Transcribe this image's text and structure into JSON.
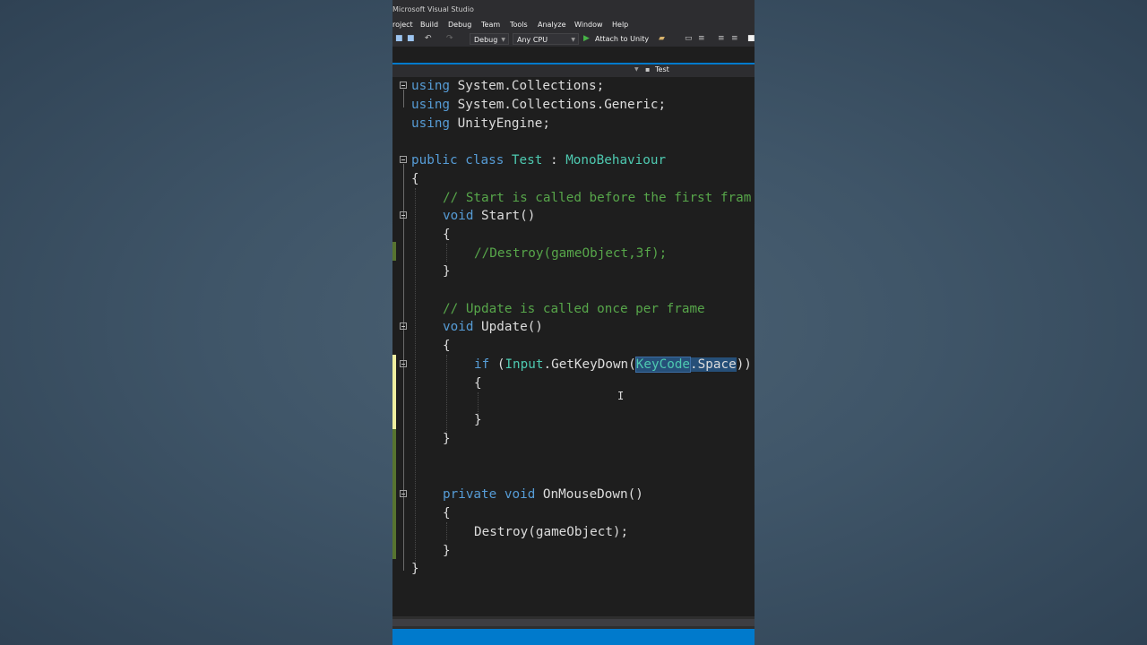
{
  "window": {
    "title": "Microsoft Visual Studio"
  },
  "menu": [
    "roject",
    "Build",
    "Debug",
    "Team",
    "Tools",
    "Analyze",
    "Window",
    "Help"
  ],
  "toolbar": {
    "config": "Debug",
    "platform": "Any CPU",
    "attach_label": "Attach to Unity",
    "icons": [
      "save-icon",
      "save-all-icon",
      "undo-icon",
      "redo-icon",
      "play-icon",
      "folder-icon",
      "bookmark-icon",
      "format-icon",
      "comment-icon"
    ]
  },
  "navbar": {
    "member": "Test"
  },
  "editor": {
    "colors": {
      "keyword": "#569cd6",
      "type": "#4ec9b0",
      "comment": "#57a64a",
      "text": "#dcdcdc"
    },
    "code": {
      "l1_kw": "using",
      "l1_rest": " System.Collections;",
      "l2_kw": "using",
      "l2_rest": " System.Collections.Generic;",
      "l3_kw": "using",
      "l3_rest": " UnityEngine;",
      "l5_kw1": "public",
      "l5_kw2": "class",
      "l5_name": "Test",
      "l5_colon": " : ",
      "l5_base": "MonoBehaviour",
      "l6": "{",
      "l7": "// Start is called before the first fram",
      "l8_kw": "void",
      "l8_rest": " Start()",
      "l9": "{",
      "l10": "//Destroy(gameObject,3f);",
      "l11": "}",
      "l13": "// Update is called once per frame",
      "l14_kw": "void",
      "l14_rest": " Update()",
      "l15": "{",
      "l16_kw": "if",
      "l16_a": " (",
      "l16_input": "Input",
      "l16_b": ".GetKeyDown(",
      "l16_keycode": "KeyCode",
      "l16_c": ".Space",
      "l16_d": "))",
      "l17": "{",
      "l19": "}",
      "l20": "}",
      "l23_kw1": "private",
      "l23_kw2": "void",
      "l23_rest": " OnMouseDown()",
      "l24": "{",
      "l25": "Destroy(gameObject);",
      "l26": "}",
      "l27": "}"
    }
  }
}
